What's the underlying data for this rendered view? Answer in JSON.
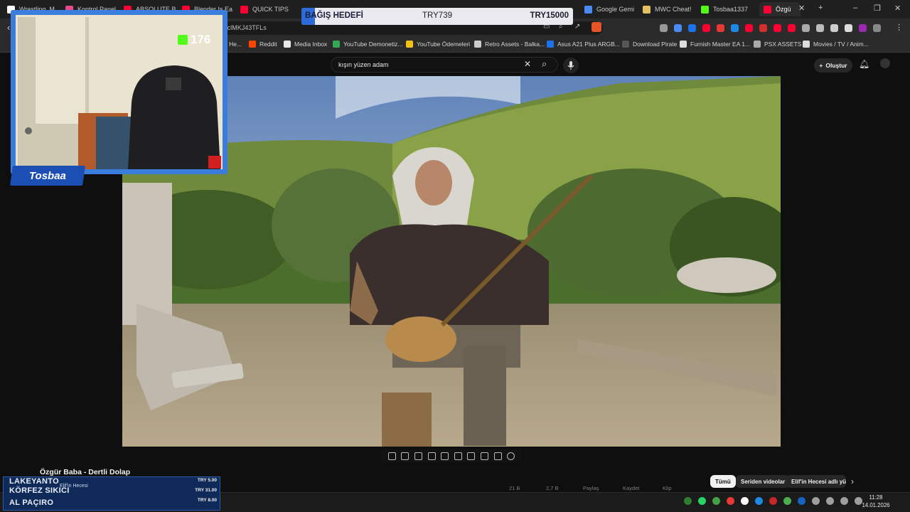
{
  "browser": {
    "tabs": [
      {
        "label": "Wrestling_M",
        "color": "#ffffff"
      },
      {
        "label": "Kontrol Panel",
        "color": "#e64a8a"
      },
      {
        "label": "ABSOLUTE B",
        "color": "#ff0033"
      },
      {
        "label": "Blender Is Ea",
        "color": "#ff0033"
      },
      {
        "label": "QUICK TIPS",
        "color": "#ff0033"
      },
      {
        "label": "Google Gemi",
        "color": "#4a8af4"
      },
      {
        "label": "MWC Cheat!",
        "color": "#e0c060"
      },
      {
        "label": "Tosbaa1337",
        "color": "#53fc18"
      },
      {
        "label": "Özgü",
        "color": "#ff0033"
      }
    ],
    "new_tab": "+",
    "url": "v=clMKJ43TFLs",
    "bookmarks": [
      {
        "label": "a He...",
        "color": "#888888"
      },
      {
        "label": "Reddit",
        "color": "#ff4500"
      },
      {
        "label": "Media Inbox",
        "color": "#e8e8e8"
      },
      {
        "label": "YouTube Demonetiz...",
        "color": "#34a853"
      },
      {
        "label": "YouTube Ödemeleri",
        "color": "#f4c20d"
      },
      {
        "label": "Retro Assets - Balka...",
        "color": "#cccccc"
      },
      {
        "label": "Asus A21 Plus ARGB...",
        "color": "#1a73e8"
      },
      {
        "label": "Download Pirate",
        "color": "#555555"
      },
      {
        "label": "Furnish Master EA 1...",
        "color": "#dddddd"
      },
      {
        "label": "PSX ASSETS",
        "color": "#aaaaaa"
      },
      {
        "label": "Movies / TV / Anim...",
        "color": "#dddddd"
      }
    ]
  },
  "youtube": {
    "search_query": "kışın yüzen adam",
    "create_label": "Oluştur",
    "video_title": "Özgür Baba - Dertli Dolap",
    "chips": [
      "Tümü",
      "Seriden videolar",
      "Elif'in Hecesi adlı yük"
    ],
    "actions": [
      "21 B",
      "2,7 B",
      "Paylaş",
      "Kaydet",
      "Klip"
    ]
  },
  "overlay": {
    "donation_label": "BAĞIŞ HEDEFİ",
    "donation_current": "TRY739",
    "donation_goal": "TRY15000",
    "donation_progress": 0.049,
    "streamer_name": "Tosbaa",
    "viewer_count": "176",
    "tips": [
      {
        "name": "LAKEYANTO",
        "amount": "TRY 5.00"
      },
      {
        "name": "KÖRFEZ SIKICI",
        "amount": "TRY 31.00"
      },
      {
        "name": "AL PAÇIRO",
        "amount": "TRY 8.00"
      }
    ],
    "tip_middle": "Elif'in Hecesi"
  },
  "taskbar": {
    "time": "11:28",
    "date": "14.01.2026"
  }
}
